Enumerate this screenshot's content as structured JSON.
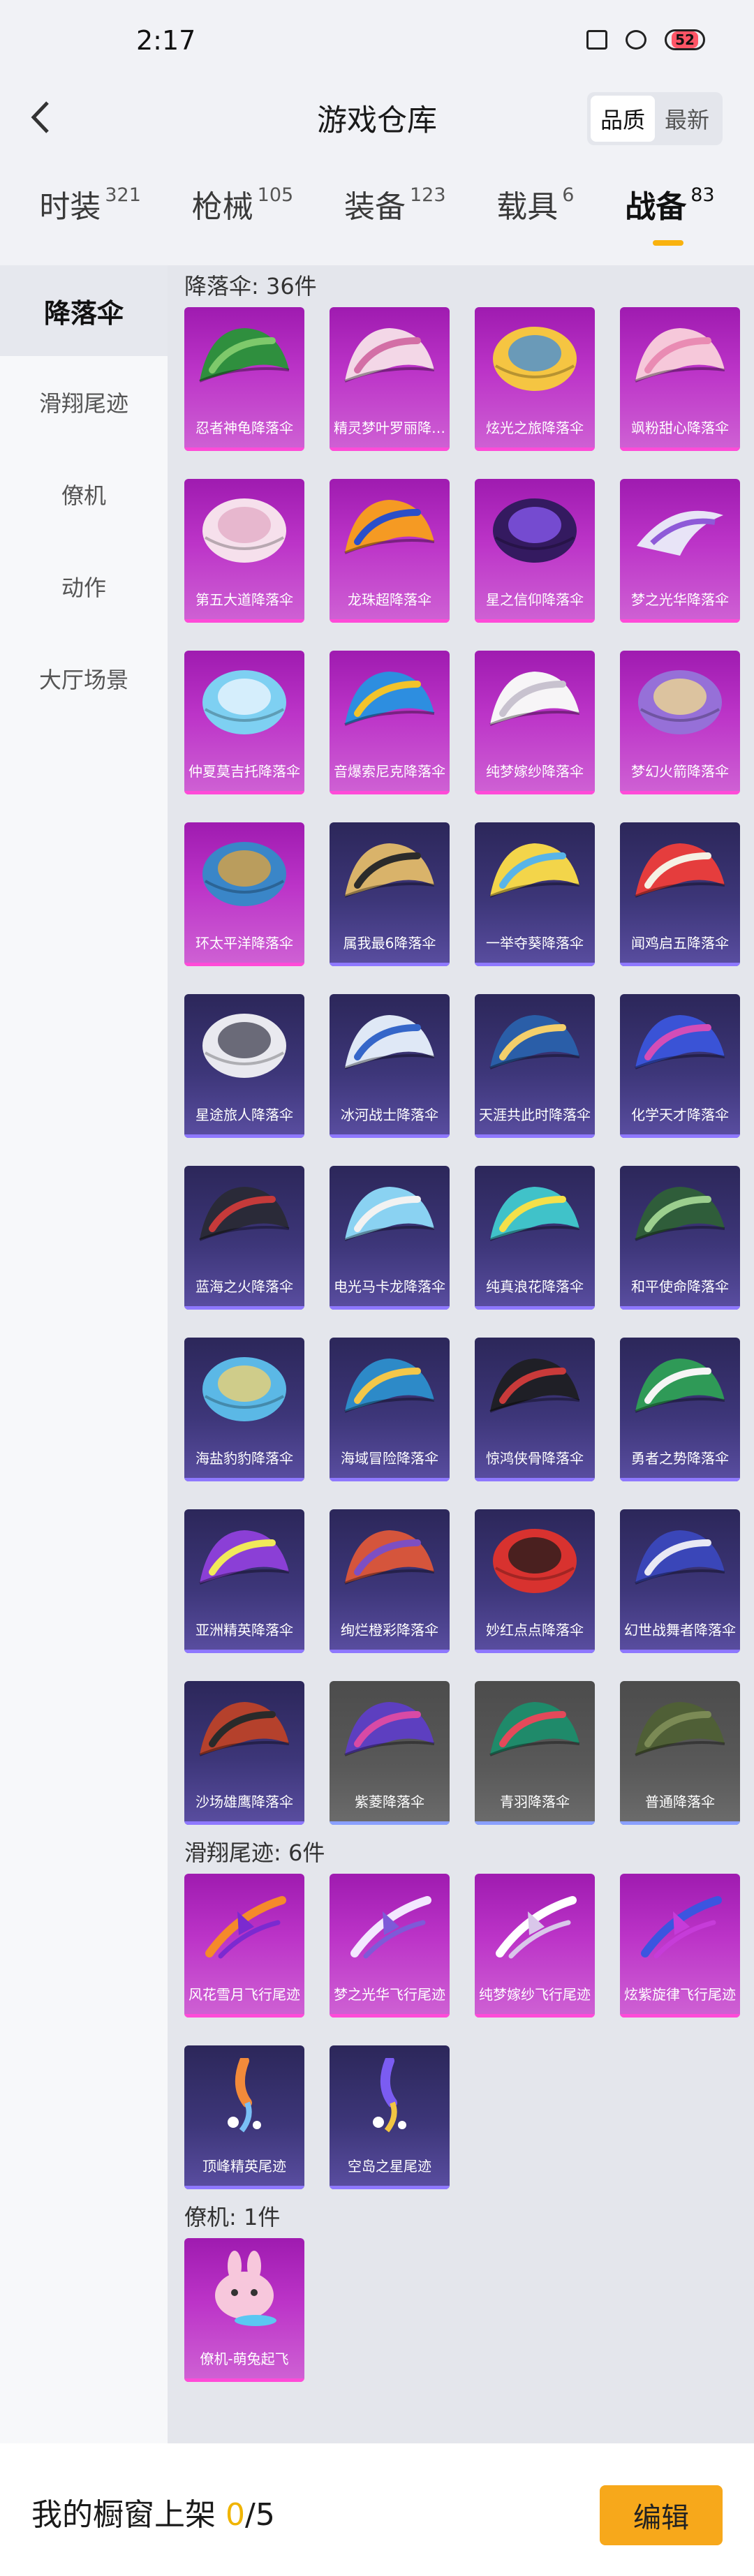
{
  "status_bar": {
    "time": "2:17",
    "battery": "52"
  },
  "header": {
    "title": "游戏仓库",
    "sort_options": [
      "品质",
      "最新"
    ],
    "sort_active": 0
  },
  "tabs": [
    {
      "label": "时装",
      "count": "321"
    },
    {
      "label": "枪械",
      "count": "105"
    },
    {
      "label": "装备",
      "count": "123"
    },
    {
      "label": "载具",
      "count": "6"
    },
    {
      "label": "战备",
      "count": "83"
    }
  ],
  "active_tab": 4,
  "sidebar": {
    "items": [
      "降落伞",
      "滑翔尾迹",
      "僚机",
      "动作",
      "大厅场景"
    ],
    "active": 0
  },
  "sections": [
    {
      "title": "降落伞: 36件",
      "items": [
        {
          "name": "忍者神龟降落伞",
          "rarity": "pink",
          "colors": [
            "#2f8f3e",
            "#7ec96b"
          ],
          "kind": "chute"
        },
        {
          "name": "精灵梦叶罗丽降落伞",
          "rarity": "pink",
          "colors": [
            "#f3d7e7",
            "#d36fa6"
          ],
          "kind": "chute"
        },
        {
          "name": "炫光之旅降落伞",
          "rarity": "pink",
          "colors": [
            "#f5c542",
            "#3b8be0"
          ],
          "kind": "round"
        },
        {
          "name": "飒粉甜心降落伞",
          "rarity": "pink",
          "colors": [
            "#f6c8da",
            "#e98bb3"
          ],
          "kind": "chute"
        },
        {
          "name": "第五大道降落伞",
          "rarity": "pink",
          "colors": [
            "#f6e0ec",
            "#e1a9c4"
          ],
          "kind": "round"
        },
        {
          "name": "龙珠超降落伞",
          "rarity": "pink",
          "colors": [
            "#f59a23",
            "#2a4fc9"
          ],
          "kind": "chute"
        },
        {
          "name": "星之信仰降落伞",
          "rarity": "pink",
          "colors": [
            "#341a60",
            "#8b5cf6"
          ],
          "kind": "round"
        },
        {
          "name": "梦之光华降落伞",
          "rarity": "pink",
          "colors": [
            "#e8e4f7",
            "#8e5ad8"
          ],
          "kind": "wing"
        },
        {
          "name": "仲夏莫吉托降落伞",
          "rarity": "pink",
          "colors": [
            "#7ed0f2",
            "#f3f8ff"
          ],
          "kind": "round"
        },
        {
          "name": "音爆索尼克降落伞",
          "rarity": "pink",
          "colors": [
            "#2d8ee0",
            "#f2c32b"
          ],
          "kind": "chute"
        },
        {
          "name": "纯梦嫁纱降落伞",
          "rarity": "pink",
          "colors": [
            "#f7f5f7",
            "#c8c2cf"
          ],
          "kind": "chute"
        },
        {
          "name": "梦幻火箭降落伞",
          "rarity": "pink",
          "colors": [
            "#9670d8",
            "#f3df8c"
          ],
          "kind": "round"
        },
        {
          "name": "环太平洋降落伞",
          "rarity": "pink",
          "colors": [
            "#3a86c8",
            "#e6a43a"
          ],
          "kind": "round"
        },
        {
          "name": "属我最6降落伞",
          "rarity": "purple",
          "colors": [
            "#d9b36a",
            "#2b2b2b"
          ],
          "kind": "chute"
        },
        {
          "name": "一举夺葵降落伞",
          "rarity": "purple",
          "colors": [
            "#f3d54a",
            "#58b4e8"
          ],
          "kind": "chute"
        },
        {
          "name": "闻鸡启五降落伞",
          "rarity": "purple",
          "colors": [
            "#e53d3d",
            "#f5f1e4"
          ],
          "kind": "chute"
        },
        {
          "name": "星途旅人降落伞",
          "rarity": "purple",
          "colors": [
            "#e9e9ef",
            "#3f3f50"
          ],
          "kind": "round"
        },
        {
          "name": "冰河战士降落伞",
          "rarity": "purple",
          "colors": [
            "#dfe8f6",
            "#3566c9"
          ],
          "kind": "chute"
        },
        {
          "name": "天涯共此时降落伞",
          "rarity": "purple",
          "colors": [
            "#2a5ea8",
            "#f4cf6b"
          ],
          "kind": "chute"
        },
        {
          "name": "化学天才降落伞",
          "rarity": "purple",
          "colors": [
            "#3a53d6",
            "#d34db7"
          ],
          "kind": "chute"
        },
        {
          "name": "蓝海之火降落伞",
          "rarity": "purple",
          "colors": [
            "#2a2a38",
            "#c53a3a"
          ],
          "kind": "chute"
        },
        {
          "name": "电光马卡龙降落伞",
          "rarity": "purple",
          "colors": [
            "#8ad2f2",
            "#f2f2f2"
          ],
          "kind": "chute"
        },
        {
          "name": "纯真浪花降落伞",
          "rarity": "purple",
          "colors": [
            "#40c2c9",
            "#f4e04a"
          ],
          "kind": "chute"
        },
        {
          "name": "和平使命降落伞",
          "rarity": "purple",
          "colors": [
            "#2f5d3a",
            "#9ccf8e"
          ],
          "kind": "chute"
        },
        {
          "name": "海盐豹豹降落伞",
          "rarity": "purple",
          "colors": [
            "#5bb8e6",
            "#f6d36b"
          ],
          "kind": "round"
        },
        {
          "name": "海域冒险降落伞",
          "rarity": "purple",
          "colors": [
            "#2d8ac8",
            "#f3c74a"
          ],
          "kind": "chute"
        },
        {
          "name": "惊鸿侠骨降落伞",
          "rarity": "purple",
          "colors": [
            "#1f1f26",
            "#c93a3a"
          ],
          "kind": "chute"
        },
        {
          "name": "勇者之势降落伞",
          "rarity": "purple",
          "colors": [
            "#2f9a57",
            "#f5f5f5"
          ],
          "kind": "chute"
        },
        {
          "name": "亚洲精英降落伞",
          "rarity": "purple",
          "colors": [
            "#8b3fd6",
            "#f1e95a"
          ],
          "kind": "chute"
        },
        {
          "name": "绚烂橙彩降落伞",
          "rarity": "purple",
          "colors": [
            "#d5553c",
            "#7d4fc2"
          ],
          "kind": "chute"
        },
        {
          "name": "妙红点点降落伞",
          "rarity": "purple",
          "colors": [
            "#d8322f",
            "#1b1b1b"
          ],
          "kind": "round"
        },
        {
          "name": "幻世战舞者降落伞",
          "rarity": "purple",
          "colors": [
            "#3a46b8",
            "#e8e8f4"
          ],
          "kind": "chute"
        },
        {
          "name": "沙场雄鹰降落伞",
          "rarity": "purple",
          "colors": [
            "#b5412c",
            "#2a2a2a"
          ],
          "kind": "chute"
        },
        {
          "name": "紫菱降落伞",
          "rarity": "grey",
          "colors": [
            "#5d3fc0",
            "#d84aa5"
          ],
          "kind": "chute"
        },
        {
          "name": "青羽降落伞",
          "rarity": "grey",
          "colors": [
            "#1f8a6a",
            "#e3495a"
          ],
          "kind": "chute"
        },
        {
          "name": "普通降落伞",
          "rarity": "grey",
          "colors": [
            "#4f5f36",
            "#7b8a55"
          ],
          "kind": "chute"
        }
      ]
    },
    {
      "title": "滑翔尾迹: 6件",
      "items": [
        {
          "name": "风花雪月飞行尾迹",
          "rarity": "pink",
          "colors": [
            "#f58a2a",
            "#7b2ad0"
          ],
          "kind": "trail"
        },
        {
          "name": "梦之光华飞行尾迹",
          "rarity": "pink",
          "colors": [
            "#f3e8ff",
            "#7e5ad8"
          ],
          "kind": "trail"
        },
        {
          "name": "纯梦嫁纱飞行尾迹",
          "rarity": "pink",
          "colors": [
            "#ffffff",
            "#d9c7ea"
          ],
          "kind": "trail"
        },
        {
          "name": "炫紫旋律飞行尾迹",
          "rarity": "pink",
          "colors": [
            "#3c55e0",
            "#c63cd9"
          ],
          "kind": "trail"
        },
        {
          "name": "顶峰精英尾迹",
          "rarity": "purple",
          "colors": [
            "#f28a3a",
            "#7ac0f5"
          ],
          "kind": "smoke"
        },
        {
          "name": "空岛之星尾迹",
          "rarity": "purple",
          "colors": [
            "#7b5cf2",
            "#f2c542"
          ],
          "kind": "smoke"
        }
      ]
    },
    {
      "title": "僚机: 1件",
      "items": [
        {
          "name": "僚机-萌兔起飞",
          "rarity": "pink",
          "colors": [
            "#f7c7dc",
            "#ffffff"
          ],
          "kind": "bunny"
        }
      ]
    }
  ],
  "bottom_bar": {
    "label": "我的橱窗上架",
    "count": "0",
    "total": "/5",
    "edit_label": "编辑"
  }
}
